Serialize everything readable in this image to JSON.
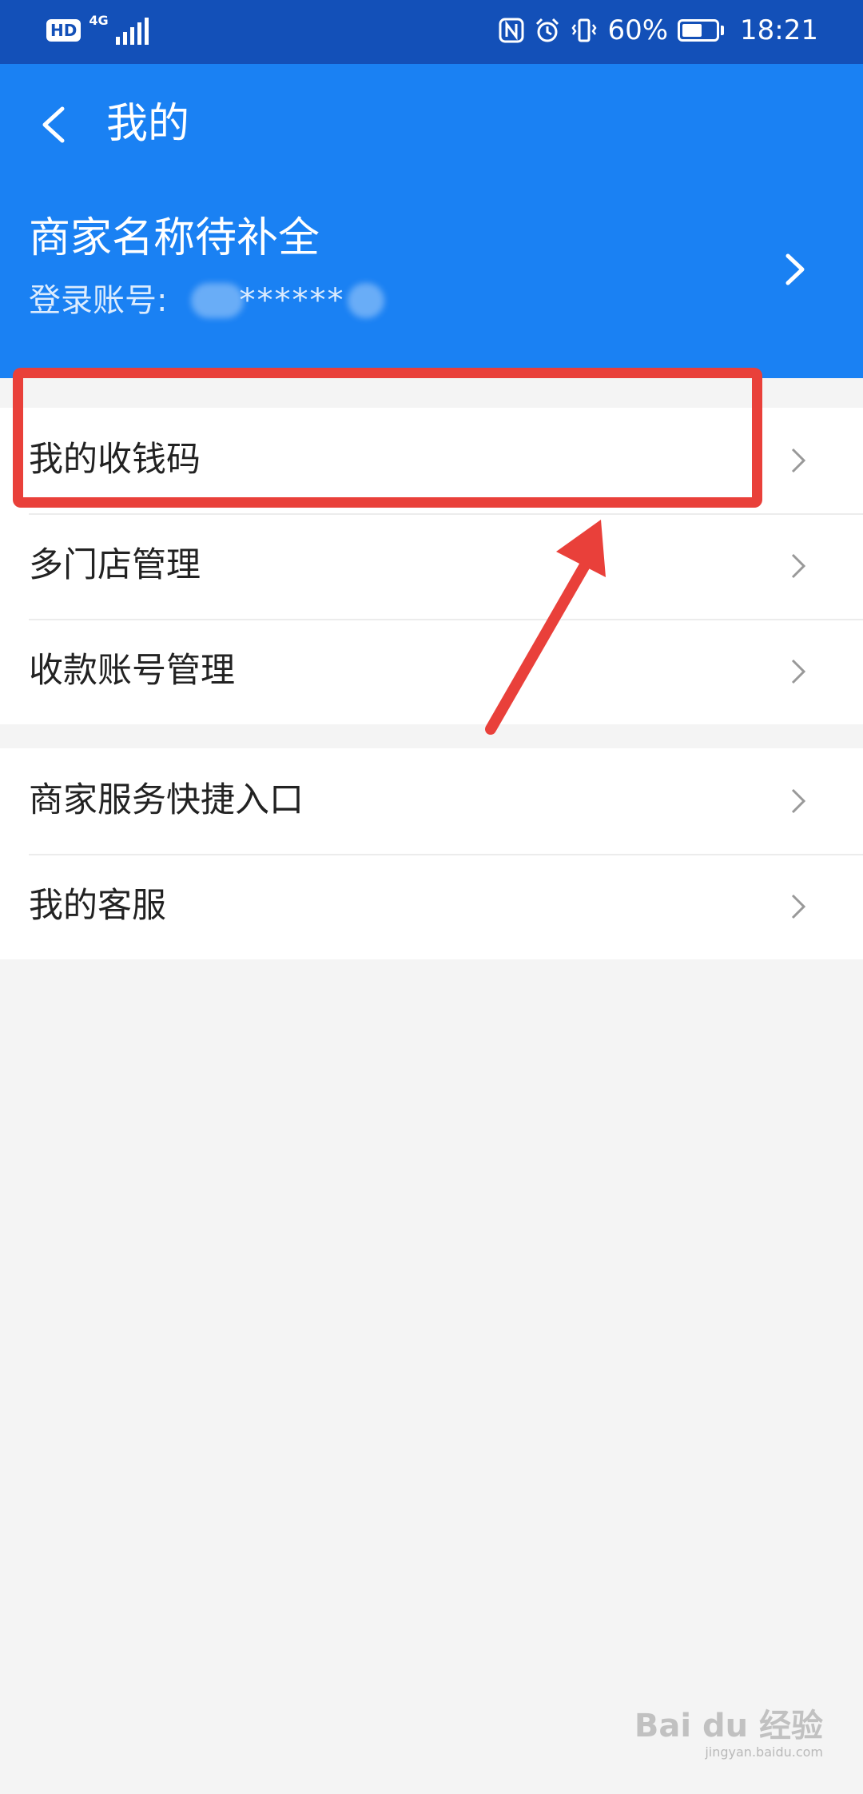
{
  "status_bar": {
    "hd_label": "HD",
    "network_label": "4G",
    "battery_text": "60%",
    "battery_level": 0.6,
    "time": "18:21",
    "icons": [
      "nfc-icon",
      "alarm-icon",
      "vibrate-icon",
      "battery-icon"
    ]
  },
  "header": {
    "title": "我的",
    "merchant_name": "商家名称待补全",
    "account_label": "登录账号:",
    "account_value": "******",
    "background_color": "#1a81f3"
  },
  "menu_groups": [
    [
      {
        "label": "我的收钱码"
      },
      {
        "label": "多门店管理"
      },
      {
        "label": "收款账号管理"
      }
    ],
    [
      {
        "label": "商家服务快捷入口"
      },
      {
        "label": "我的客服"
      }
    ]
  ],
  "annotation": {
    "highlight_color": "#e9403a"
  },
  "watermark": {
    "text": "Bai du 经验",
    "sub": "jingyan.baidu.com"
  }
}
